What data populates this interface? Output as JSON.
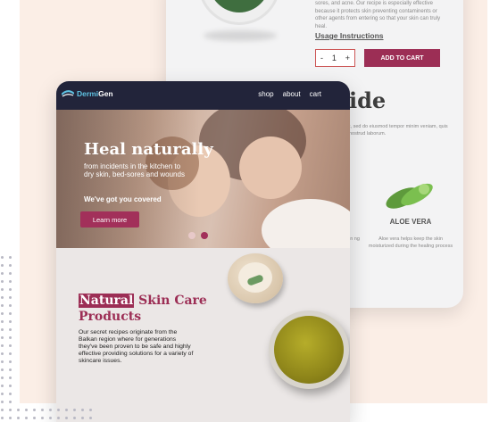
{
  "back_card": {
    "description": "sores, and acne. Our recipe is especially effective because it protects skin preventing contaminents or other agents from entering so that your skin can truly heal.",
    "usage_link": "Usage Instructions",
    "quantity": {
      "minus": "-",
      "value": "1",
      "plus": "+"
    },
    "add_to_cart": "ADD TO CART",
    "heading_fragment": "ide",
    "lorem_fragment": "t, sed do eiusmod tempor minim veniam, quis nostrud laborum.",
    "ingredient": {
      "name": "ALOE VERA",
      "description": "Aloe vera helps keep the skin moisturized during the healing process"
    },
    "left_fragment": "in ng"
  },
  "nav": {
    "logo_prefix": "Dermi",
    "logo_suffix": "Gen",
    "links": [
      "shop",
      "about",
      "cart"
    ]
  },
  "hero": {
    "title": "Heal naturally",
    "subtitle": "from incidents in the kitchen to dry skin, bed-sores and wounds",
    "tagline": "We've got you covered",
    "cta": "Learn more",
    "pager_colors": [
      "#e8c9c9",
      "#a2305a"
    ]
  },
  "section": {
    "title_highlight": "Natural",
    "title_rest": " Skin Care",
    "title_line2": "Products",
    "description": "Our secret recipes originate from the Balkan region where for generations they've been proven to be safe and highly effective providing solutions for a variety of skincare issues."
  },
  "colors": {
    "brand": "#9c2e55",
    "nav_bg": "#22243a",
    "logo_accent": "#5fc3e4",
    "peach_bg": "#fbeee6"
  }
}
